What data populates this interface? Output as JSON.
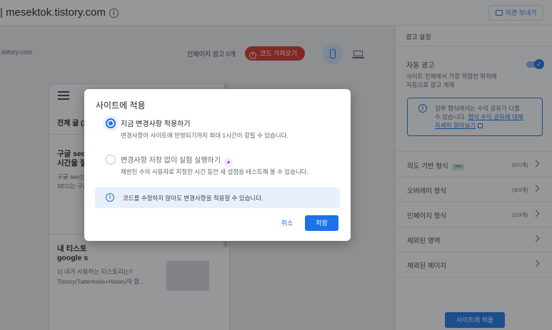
{
  "header": {
    "site_title": "| mesektok.tistory.com",
    "info_icon": "info-icon",
    "feedback_label": "의견 보내기",
    "feedback_icon": "feedback-icon"
  },
  "preview": {
    "domain": ".tistory.com",
    "inpage_ads_label": "인페이지 광고 0개",
    "get_code_label": "코드 가져오기",
    "device_icons": [
      "mobile-icon",
      "desktop-icon"
    ],
    "selected_device": "mobile",
    "category_heading": "전체 글 (2",
    "posts": [
      {
        "title_lines": [
          "구글 seo",
          "시간을 절"
        ],
        "excerpt_lines": [
          "구글 seo는",
          "SEO는 구글"
        ]
      },
      {
        "title_lines": [
          "내 티스토",
          "google s"
        ],
        "excerpt_lines": [
          "1) 내가 사용하는 티스토리는?",
          "Tistory(Tattertools+history의 합..."
        ]
      }
    ]
  },
  "panel": {
    "heading": "광고 설정",
    "auto_ads": {
      "label": "자동 광고",
      "enabled": true,
      "desc_lines": [
        "사이트 전체에서 가장 적합한 위치에",
        "자동으로 광고 게재"
      ]
    },
    "info_box": {
      "lines": [
        "일부 형식에서는 수익 공유가 다를",
        "수 있습니다."
      ],
      "link_part1": "형식 수익 공유에 대해",
      "link_part2": "자세히 알아보기"
    },
    "rows": [
      {
        "label": "의도 기반 형식",
        "badge": "new",
        "count": "(0/1개)"
      },
      {
        "label": "오버레이 형식",
        "badge": "",
        "count": "(3/3개)"
      },
      {
        "label": "인페이지 형식",
        "badge": "",
        "count": "(1/3개)"
      },
      {
        "label": "제외된 영역",
        "badge": "",
        "count": ""
      },
      {
        "label": "제외된 페이지",
        "badge": "",
        "count": ""
      }
    ],
    "apply_label": "사이트에 적용"
  },
  "dialog": {
    "title": "사이트에 적용",
    "options": [
      {
        "title": "지금 변경사항 적용하기",
        "desc": "변경사항이 사이트에 반영되기까지 최대 1시간이 걸릴 수 있습니다.",
        "selected": true
      },
      {
        "title": "변경사항 저장 없이 실험 실행하기",
        "desc": "제한된 수의 사용자로 지정된 시간 동안 새 설정을 테스트해 볼 수 있습니다.",
        "selected": false
      }
    ],
    "notice": "코드를 수정하지 않아도 변경사항을 적용할 수 있습니다.",
    "cancel_label": "취소",
    "save_label": "저장"
  },
  "colors": {
    "accent": "#1a73e8",
    "danger": "#d93025",
    "scrim": "rgba(32,33,36,0.47)"
  }
}
